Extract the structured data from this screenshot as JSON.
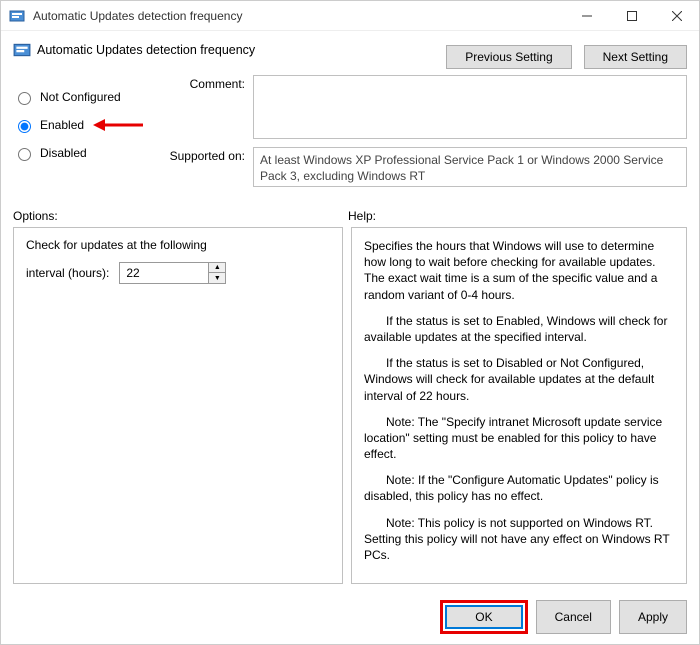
{
  "window": {
    "title": "Automatic Updates detection frequency"
  },
  "header": {
    "title": "Automatic Updates detection frequency",
    "prev_btn": "Previous Setting",
    "next_btn": "Next Setting"
  },
  "radios": {
    "not_configured": "Not Configured",
    "enabled": "Enabled",
    "disabled": "Disabled",
    "selected": "enabled"
  },
  "labels": {
    "comment": "Comment:",
    "supported": "Supported on:",
    "options": "Options:",
    "help": "Help:"
  },
  "fields": {
    "comment_value": "",
    "supported_value": "At least Windows XP Professional Service Pack 1 or Windows 2000 Service Pack 3, excluding Windows RT"
  },
  "options_pane": {
    "line1": "Check for updates at the following",
    "interval_label": "interval (hours):",
    "interval_value": "22"
  },
  "help_pane": {
    "p1": "Specifies the hours that Windows will use to determine how long to wait before checking for available updates. The exact wait time is a sum of the specific value and a random variant of 0-4 hours.",
    "p2": "If the status is set to Enabled, Windows will check for available updates at the specified interval.",
    "p3": "If the status is set to Disabled or Not Configured, Windows will check for available updates at the default interval of 22 hours.",
    "p4": "Note: The \"Specify intranet Microsoft update service location\" setting must be enabled for this policy to have effect.",
    "p5": "Note: If the \"Configure Automatic Updates\" policy is disabled, this policy has no effect.",
    "p6": "Note: This policy is not supported on Windows RT. Setting this policy will not have any effect on Windows RT PCs."
  },
  "buttons": {
    "ok": "OK",
    "cancel": "Cancel",
    "apply": "Apply"
  }
}
